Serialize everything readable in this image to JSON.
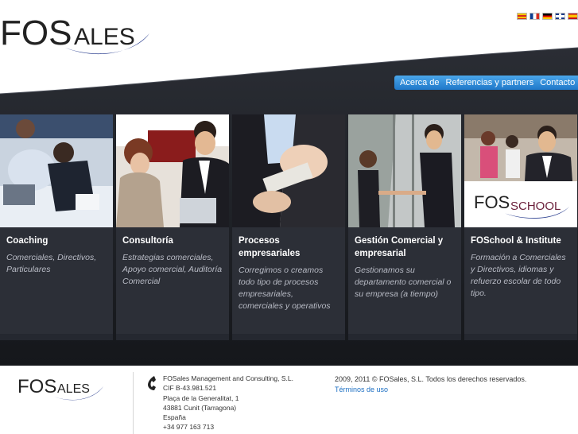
{
  "header": {
    "logo_fos": "FOS",
    "logo_ales": "ALES",
    "languages": [
      "catalan-flag-icon",
      "french-flag-icon",
      "german-flag-icon",
      "english-flag-icon",
      "spanish-flag-icon"
    ]
  },
  "nav": {
    "items": [
      "Acerca de",
      "Referencias y partners",
      "Contacto"
    ]
  },
  "columns": [
    {
      "title": "Coaching",
      "text": "Comerciales, Directivos, Particulares"
    },
    {
      "title": "Consultoría",
      "text": "Estrategias comerciales, Apoyo comercial, Auditoría Comercial"
    },
    {
      "title": "Procesos empresariales",
      "text": "Corregimos o creamos todo tipo de procesos empresariales, comerciales y operativos"
    },
    {
      "title": "Gestión Comercial y empresarial",
      "text": "Gestionamos su departamento comercial o su empresa (a tiempo)"
    },
    {
      "title": "FOSchool & Institute",
      "text": "Formación a Comerciales y Directivos, idiomas y refuerzo escolar de todo tipo."
    }
  ],
  "foschool_logo": {
    "fos": "FOS",
    "school": "SCHOOL"
  },
  "footer": {
    "logo_fos": "FOS",
    "logo_ales": "ALES",
    "company": "FOSales Management and Consulting, S.L.",
    "cif": "CIF B-43.981.521",
    "street": "Plaça de la Generalitat, 1",
    "city": "43881 Cunit (Tarragona)",
    "country": "España",
    "phone": "+34 977 163 713",
    "copyright": "2009, 2011 © FOSales, S.L. Todos los derechos reservados.",
    "terms": "Términos de uso"
  },
  "colors": {
    "accent": "#1f78c9",
    "dark": "#1b1d22",
    "logo_swoosh": "#2b3f8f"
  }
}
